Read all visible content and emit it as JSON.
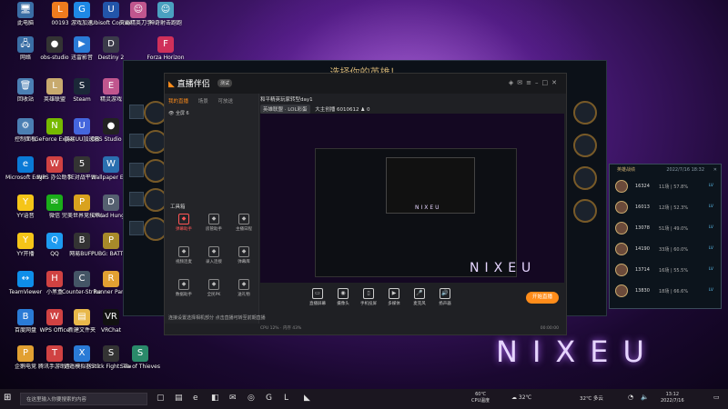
{
  "desktop": {
    "wallpaper_text": "NIXEU",
    "icons": [
      {
        "label": "此电脑",
        "glyph": "🖥",
        "color": "#3a6ea5"
      },
      {
        "label": "00193",
        "glyph": "L",
        "color": "#ef7b1e"
      },
      {
        "label": "游戏加速",
        "glyph": "G",
        "color": "#1e88e5"
      },
      {
        "label": "Ubisoft Connect",
        "glyph": "U",
        "color": "#2255aa"
      },
      {
        "label": "灭霸精英刀手…",
        "glyph": "☺",
        "color": "#c0568e"
      },
      {
        "label": "神奇射击跑跑",
        "glyph": "☺",
        "color": "#4aa0c0"
      },
      {
        "label": "网络",
        "glyph": "🖧",
        "color": "#3a6ea5"
      },
      {
        "label": "obs-studio",
        "glyph": "●",
        "color": "#333333"
      },
      {
        "label": "迅雷影音",
        "glyph": "▶",
        "color": "#2a7bd6"
      },
      {
        "label": "Destiny 2",
        "glyph": "D",
        "color": "#3b3b4a"
      },
      {
        "label": "Forza Horizon",
        "glyph": "F",
        "color": "#d0305a"
      },
      {
        "label": "回收站",
        "glyph": "🗑",
        "color": "#4b7fb3"
      },
      {
        "label": "英雄联盟",
        "glyph": "L",
        "color": "#c8aa6e"
      },
      {
        "label": "Steam",
        "glyph": "S",
        "color": "#1b2838"
      },
      {
        "label": "精灵游戏",
        "glyph": "E",
        "color": "#c0568e"
      },
      {
        "label": "控制面板",
        "glyph": "⚙",
        "color": "#4b7fb3"
      },
      {
        "label": "GeForce Experience",
        "glyph": "N",
        "color": "#76b900"
      },
      {
        "label": "网易UU加速器",
        "glyph": "U",
        "color": "#4466dd"
      },
      {
        "label": "OBS Studio (64bit)",
        "glyph": "●",
        "color": "#222222"
      },
      {
        "label": "Microsoft Edge",
        "glyph": "e",
        "color": "#0a7ad6"
      },
      {
        "label": "WPS 办公助手",
        "glyph": "W",
        "color": "#d04242"
      },
      {
        "label": "5E对战平台",
        "glyph": "5",
        "color": "#333333"
      },
      {
        "label": "Wallpaper Engine",
        "glyph": "W",
        "color": "#2a6fb0"
      },
      {
        "label": "YY语音",
        "glyph": "Y",
        "color": "#f5c518"
      },
      {
        "label": "微信",
        "glyph": "✉",
        "color": "#1aad19"
      },
      {
        "label": "完美世界竞技平台",
        "glyph": "P",
        "color": "#d9a21e"
      },
      {
        "label": "Dread Hunger",
        "glyph": "D",
        "color": "#556070"
      },
      {
        "label": "YY开播",
        "glyph": "Y",
        "color": "#f5c518"
      },
      {
        "label": "QQ",
        "glyph": "Q",
        "color": "#1d9bf0"
      },
      {
        "label": "网易BUFF",
        "glyph": "B",
        "color": "#333333"
      },
      {
        "label": "PUBG: BATTLEGROUNDS",
        "glyph": "P",
        "color": "#a88a2a"
      },
      {
        "label": "TeamViewer",
        "glyph": "↔",
        "color": "#0e8ee9"
      },
      {
        "label": "小黑盒",
        "glyph": "H",
        "color": "#d04242"
      },
      {
        "label": "Counter-Strike: Global Off…",
        "glyph": "C",
        "color": "#445566"
      },
      {
        "label": "Runner Party",
        "glyph": "R",
        "color": "#e2a032"
      },
      {
        "label": "百度网盘",
        "glyph": "B",
        "color": "#2a7bd6"
      },
      {
        "label": "WPS Office",
        "glyph": "W",
        "color": "#d04242"
      },
      {
        "label": "新建文件夹",
        "glyph": "▤",
        "color": "#e8b84a"
      },
      {
        "label": "VRChat",
        "glyph": "VR",
        "color": "#111111"
      },
      {
        "label": "企鹅电竞",
        "glyph": "P",
        "color": "#e2a032"
      },
      {
        "label": "腾讯手游助手",
        "glyph": "T",
        "color": "#d04242"
      },
      {
        "label": "逍遥模拟器7.0",
        "glyph": "X",
        "color": "#2a7bd6"
      },
      {
        "label": "Stick Fight: The Game",
        "glyph": "S",
        "color": "#333333"
      },
      {
        "label": "Sea of Thieves",
        "glyph": "S",
        "color": "#2a8a6a"
      }
    ]
  },
  "game_window": {
    "title": "选择你的英雄！"
  },
  "app": {
    "logo": "直播伴侣",
    "version_badge": "测试",
    "tabs": [
      "我的直播",
      "场景",
      "可放送"
    ],
    "scene_label": "全屏 6",
    "tools_title": "工具箱",
    "tools": [
      {
        "label": "弹幕助手",
        "hot": true
      },
      {
        "label": "房管助手",
        "hot": false
      },
      {
        "label": "主播日程",
        "hot": false
      },
      {
        "label": "视频连麦",
        "hot": false
      },
      {
        "label": "录入连接",
        "hot": false
      },
      {
        "label": "弹幕库",
        "hot": false
      },
      {
        "label": "数据助手",
        "hot": false
      },
      {
        "label": "全民PK",
        "hot": false
      },
      {
        "label": "送礼物",
        "hot": false
      }
    ],
    "stream_title": "和平精英玩家转型day1",
    "category_tag": "英雄联盟 · LOL彩蛋",
    "room_info": "大主创播 6010612",
    "viewer_count": "0",
    "buttons": [
      {
        "label": "直播屏幕",
        "icon": "▭"
      },
      {
        "label": "摄像头",
        "icon": "◉"
      },
      {
        "label": "手机投屏",
        "icon": "▯"
      },
      {
        "label": "多媒体",
        "icon": "▶"
      },
      {
        "label": "麦克风",
        "icon": "🎤"
      },
      {
        "label": "扬声器",
        "icon": "🔊"
      }
    ],
    "go_live": "开始直播",
    "notice": "连接设置选择相机部分 点击直播可转至前期直播",
    "status": "CPU 12% · 内存 43%",
    "timer": "00:00:00"
  },
  "hero_stats": {
    "title": "英雄战绩",
    "timestamp": "2022/7/16 18:32",
    "rows": [
      {
        "id": "16324",
        "record": "11场 | 57.8%",
        "spell": "LV"
      },
      {
        "id": "16013",
        "record": "12场 | 52.3%",
        "spell": "LV"
      },
      {
        "id": "13078",
        "record": "51场 | 49.0%",
        "spell": "LV"
      },
      {
        "id": "14190",
        "record": "33场 | 60.0%",
        "spell": "LV"
      },
      {
        "id": "13714",
        "record": "16场 | 55.5%",
        "spell": "LV"
      },
      {
        "id": "13830",
        "record": "18场 | 66.6%",
        "spell": "LV"
      }
    ]
  },
  "taskbar": {
    "search_placeholder": "在这里输入你要搜索的内容",
    "weather_line1": "60℃",
    "weather_line2": "CPU温度",
    "temp": "32℃",
    "temp_label": "32℃ 多云",
    "time": "13:12",
    "date": "2022/7/16"
  }
}
